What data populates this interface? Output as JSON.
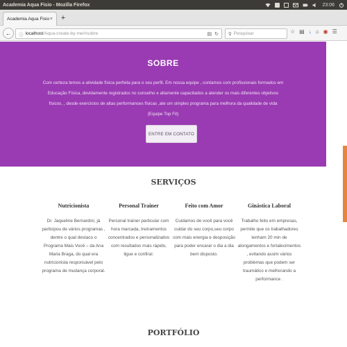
{
  "os": {
    "window_title": "Academia Aqua Fisio - Mozilla Firefox",
    "time": "23:06"
  },
  "browser": {
    "tab_title": "Academia Aqua Fisio",
    "tab_close": "×",
    "new_tab": "+",
    "url_host": "localhost",
    "url_path": "/Aqua-create-by-me/#sobre",
    "search_placeholder": "Pesquisar",
    "toolbar_icons": [
      "star-icon",
      "bookmarks-icon",
      "download-icon",
      "home-icon",
      "pocket-icon",
      "menu-icon"
    ]
  },
  "sobre": {
    "title": "SOBRE",
    "text": "Com certeza temos a atividade física perfeita para o seu perfil. Em nossa equipe , contamos com profissionais formados em Educação Física, devidamente registrados no conselho e altamente capacitados a atender os mais diferentes objetivos físicos, , desde exercícios de altas performances físicas ,ate um simples programa para melhora da qualidade de vida (Equipe Top Fit)",
    "button_label": "ENTRE EM CONTATO"
  },
  "servicos": {
    "title": "SERVIÇOS",
    "items": [
      {
        "title": "Nutricionista",
        "text": "Dr. Jaqueline Bernardini, já participou de vários programas , dentre o qual destaco o Programa Mais Você – da Ana Maria Braga, do qual era nutricionista responsável pelo programa de mudança corporal."
      },
      {
        "title": "Personal Trainer",
        "text": "Personal trainer particular com hora marcada, treinamentos concentrados e personalizados com resultados mais rápido, ligue e confira!."
      },
      {
        "title": "Feito com Amor",
        "text": "Cuidamos de você para você cuidar do seu corpo,seu corpo com mais energia e desposição para poder encarar o dia a dia bem disposto."
      },
      {
        "title": "Ginástica Laboral",
        "text": "Trabalho feito em empresas, permite que os trabalhadores tenham 20 min de alongamentos e fortalecimentos , evitando assim vários problemas que podem ser traumático e melhorando a performance ."
      }
    ]
  },
  "portfolio": {
    "title": "PORTFÓLIO"
  },
  "colors": {
    "sobre_bg": "#9a3bb3",
    "scroll_accent": "#e8853c",
    "os_bar": "#3c3b37"
  }
}
